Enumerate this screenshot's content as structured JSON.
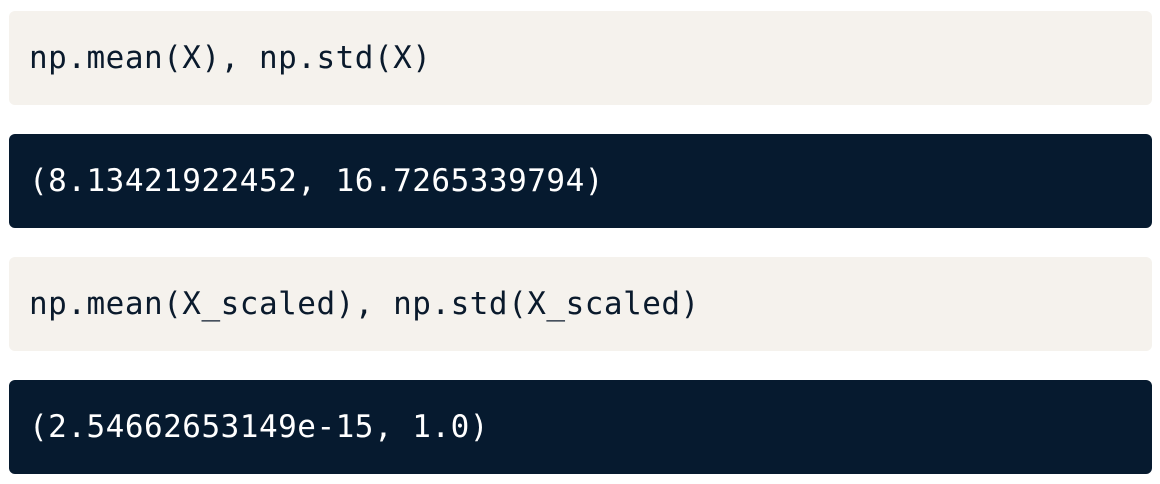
{
  "cells": [
    {
      "kind": "code",
      "text": "np.mean(X), np.std(X)"
    },
    {
      "kind": "output",
      "text": "(8.13421922452, 16.7265339794)"
    },
    {
      "kind": "code",
      "text": "np.mean(X_scaled), np.std(X_scaled)"
    },
    {
      "kind": "output",
      "text": "(2.54662653149e-15, 1.0)"
    }
  ],
  "colors": {
    "code_background": "#f5f2ed",
    "code_text": "#0a1a2c",
    "output_background": "#061a2f",
    "output_text": "#ffffff"
  }
}
